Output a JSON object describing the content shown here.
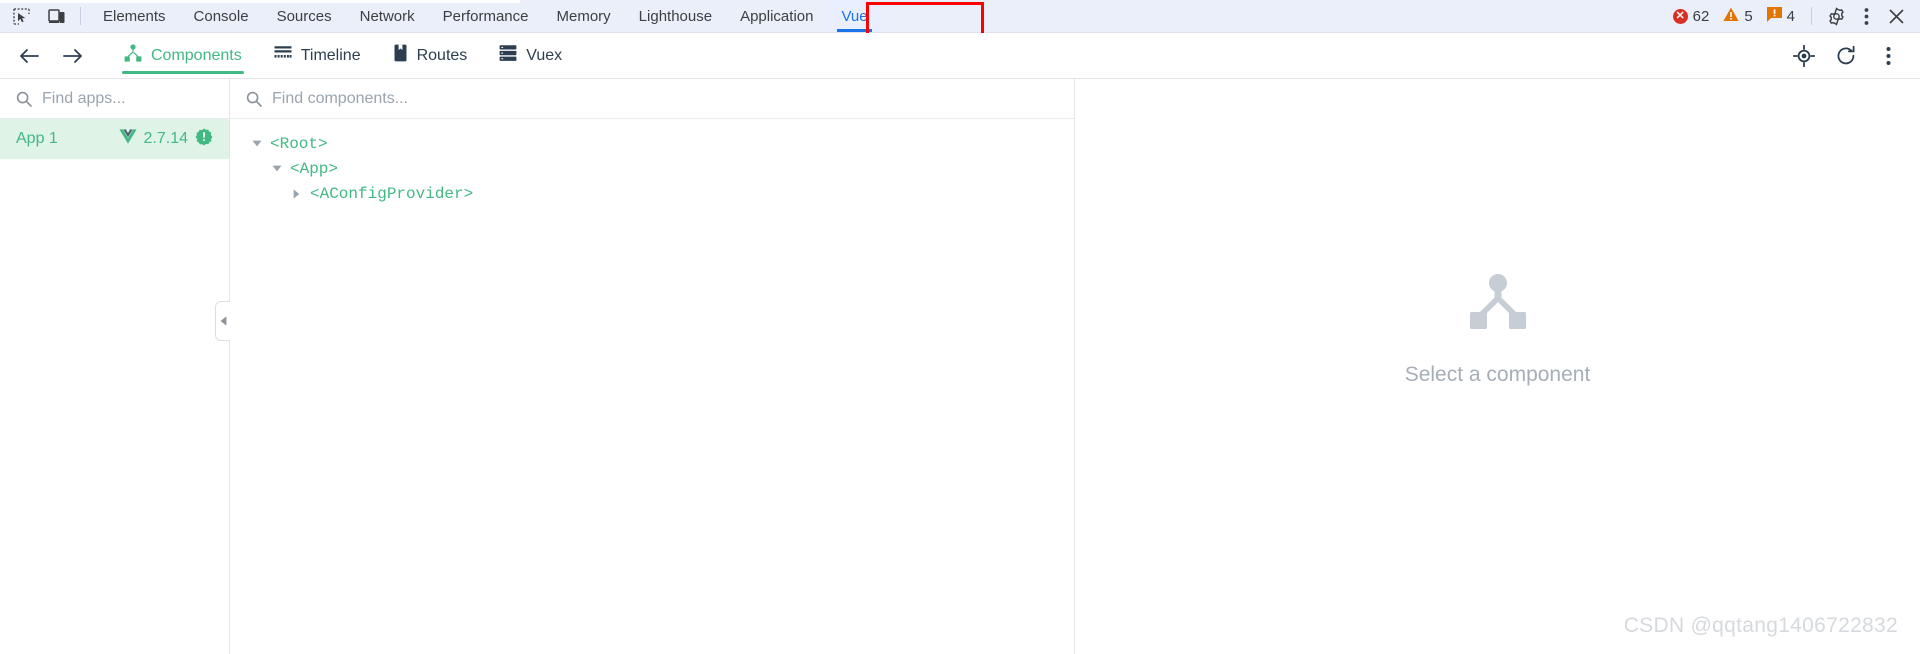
{
  "browser_devtools": {
    "left_icons": [
      {
        "name": "inspect-element-icon",
        "label": "Inspect element"
      },
      {
        "name": "device-toolbar-icon",
        "label": "Toggle device toolbar"
      }
    ],
    "tabs": [
      {
        "label": "Elements",
        "active": false
      },
      {
        "label": "Console",
        "active": false
      },
      {
        "label": "Sources",
        "active": false
      },
      {
        "label": "Network",
        "active": false
      },
      {
        "label": "Performance",
        "active": false
      },
      {
        "label": "Memory",
        "active": false
      },
      {
        "label": "Lighthouse",
        "active": false
      },
      {
        "label": "Application",
        "active": false
      },
      {
        "label": "Vue",
        "active": true
      }
    ],
    "counters": {
      "errors": "62",
      "warnings": "5",
      "issues": "4"
    },
    "right_icons": [
      {
        "name": "settings-gear-icon"
      },
      {
        "name": "more-options-icon"
      },
      {
        "name": "close-devtools-icon"
      }
    ],
    "annotation": {
      "target": "Vue",
      "color": "#ff0000"
    }
  },
  "vue_devtools": {
    "nav": {
      "back_label": "Back",
      "forward_label": "Forward"
    },
    "tabs": [
      {
        "label": "Components",
        "icon": "components-tree-icon",
        "active": true
      },
      {
        "label": "Timeline",
        "icon": "timeline-icon",
        "active": false
      },
      {
        "label": "Routes",
        "icon": "routes-bookmark-icon",
        "active": false
      },
      {
        "label": "Vuex",
        "icon": "vuex-store-icon",
        "active": false
      }
    ],
    "toolbar_right_icons": [
      {
        "name": "select-component-target-icon"
      },
      {
        "name": "refresh-icon"
      },
      {
        "name": "more-menu-icon"
      }
    ],
    "apps_pane": {
      "search_placeholder": "Find apps...",
      "search_value": "",
      "apps": [
        {
          "name": "App 1",
          "version": "2.7.14",
          "selected": true,
          "badge": "issue-badge"
        }
      ],
      "collapse_handle": "collapse-sidebar-handle"
    },
    "tree_pane": {
      "search_placeholder": "Find components...",
      "search_value": "",
      "nodes": [
        {
          "label": "<Root>",
          "depth": 0,
          "expanded": true,
          "has_children": true
        },
        {
          "label": "<App>",
          "depth": 1,
          "expanded": true,
          "has_children": true
        },
        {
          "label": "<AConfigProvider>",
          "depth": 2,
          "expanded": false,
          "has_children": true
        }
      ]
    },
    "detail_pane": {
      "empty_icon": "component-hierarchy-icon",
      "empty_text": "Select a component"
    }
  },
  "watermark": {
    "text": "CSDN @qqtang1406722832"
  },
  "colors": {
    "vue_green": "#42b983",
    "chrome_blue": "#1a73e8",
    "annotation_red": "#ff0000",
    "error_red": "#d93025",
    "warning_orange": "#e37400"
  }
}
